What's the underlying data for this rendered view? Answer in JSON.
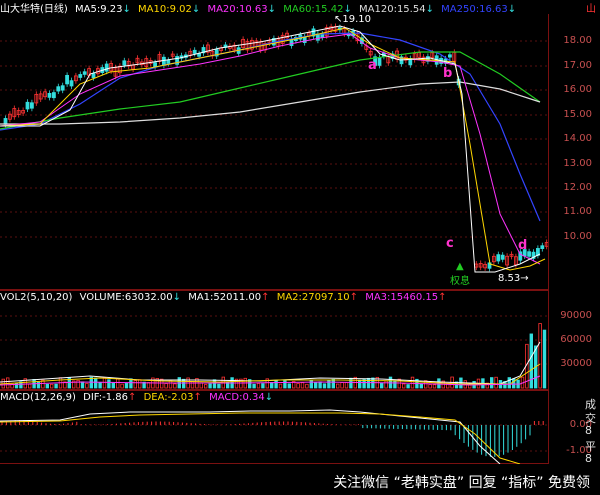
{
  "header": {
    "title": "山大华特(日线)",
    "ma5": "MA5:9.23",
    "ma10": "MA10:9.02",
    "ma20": "MA20:10.63",
    "ma60": "MA60:15.42",
    "ma120": "MA120:15.54",
    "ma250": "MA250:16.63",
    "down_arrow": "↓",
    "flag": "山"
  },
  "colors": {
    "ma5": "#ffffff",
    "ma10": "#ffd700",
    "ma20": "#ff33ff",
    "ma60": "#22cc22",
    "ma120": "#dddddd",
    "ma250": "#3344ff",
    "up": "#ff3333",
    "down": "#33dddd",
    "axis": "#c85050"
  },
  "price_axis": {
    "ticks": [
      "18.00",
      "17.00",
      "16.00",
      "15.00",
      "14.00",
      "13.00",
      "12.00",
      "11.00",
      "10.00"
    ]
  },
  "price_labels": {
    "high": "19.10",
    "low": "8.53",
    "quan_label": "权息",
    "arrow_right": "→"
  },
  "markers": {
    "a": "a",
    "b": "b",
    "c": "c",
    "d": "d"
  },
  "volume_panel": {
    "label": "VOL2(5,10,20)",
    "volume": "VOLUME:63032.00",
    "ma1": "MA1:52011.00",
    "ma2": "MA2:27097.10",
    "ma3": "MA3:15460.15",
    "arrow_down": "↓",
    "arrow_up": "↑",
    "ticks": [
      "90000",
      "60000",
      "30000"
    ]
  },
  "macd_panel": {
    "label": "MACD(12,26,9)",
    "dif": "DIF:-1.86",
    "dea": "DEA:-2.03",
    "macd": "MACD:0.34",
    "arrow_up": "↑",
    "arrow_down": "↓",
    "ticks": [
      "0.00",
      "-1.00"
    ]
  },
  "side_text": [
    "成",
    "交",
    "8",
    "平",
    "8"
  ],
  "watermark": "关注微信 “老韩实盘” 回复 “指标” 免费领"
}
